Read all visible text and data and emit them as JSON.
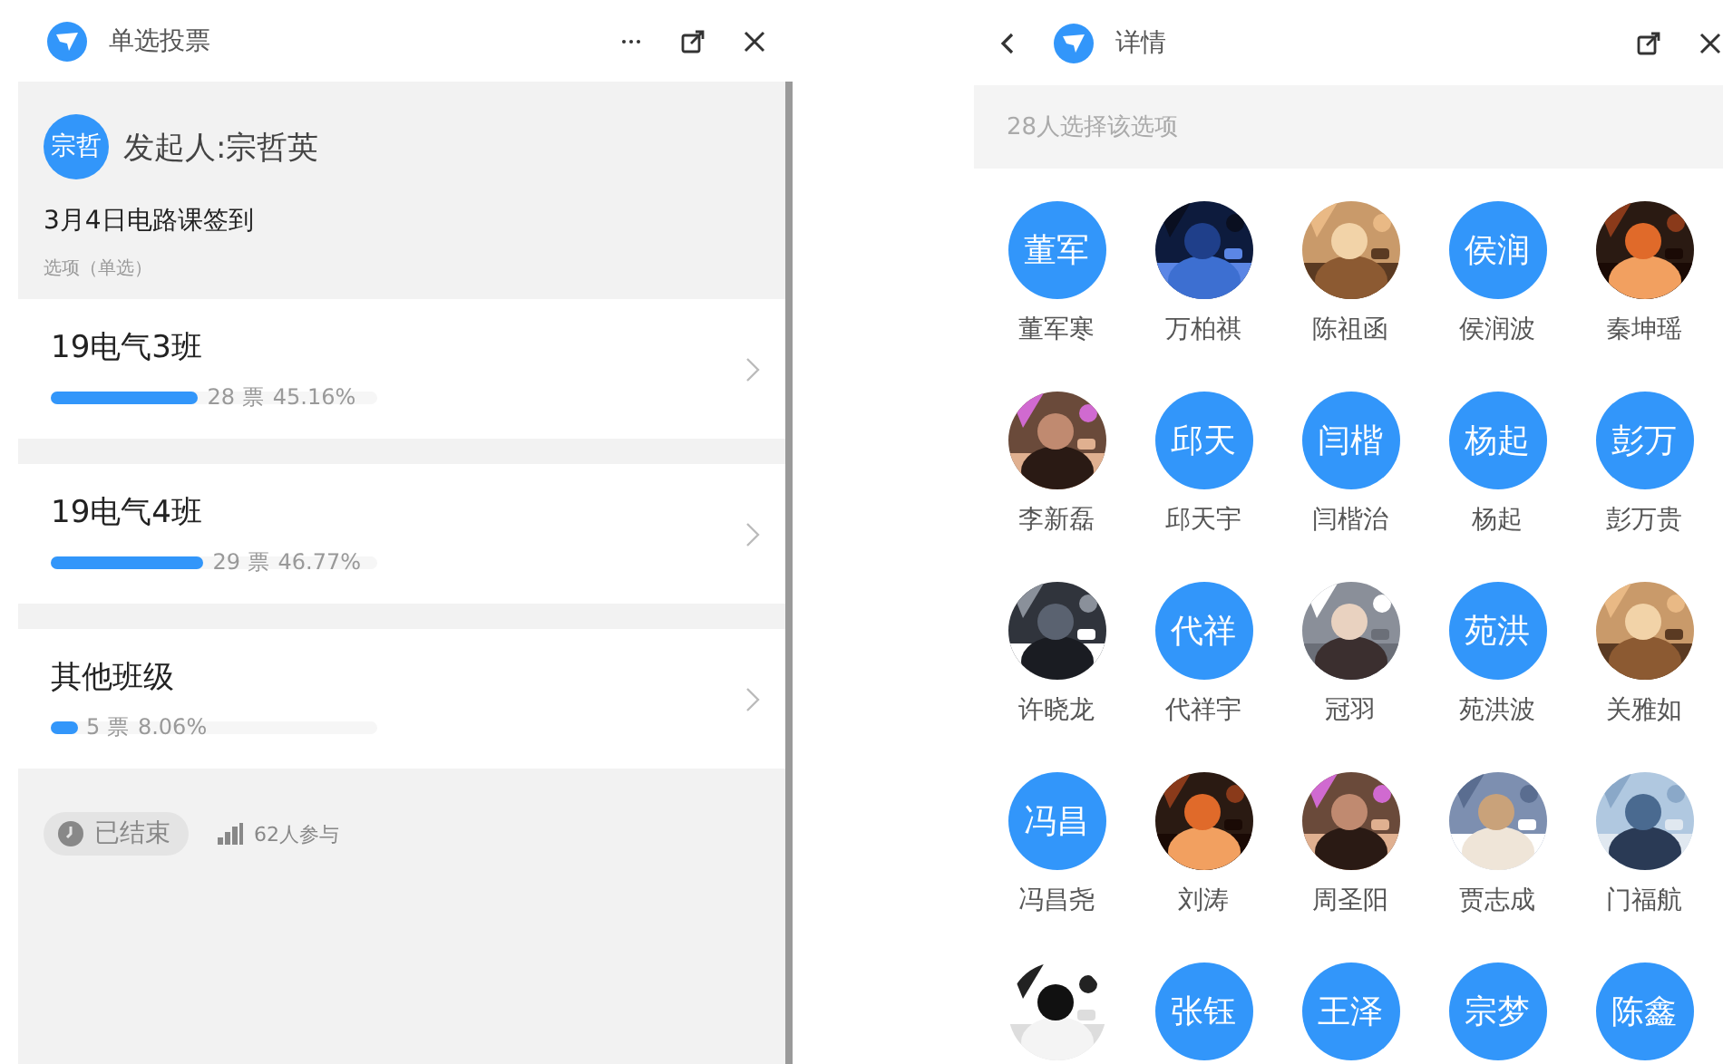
{
  "vote_window": {
    "title": "单选投票",
    "creator": {
      "avatar_text": "宗哲",
      "label": "发起人:宗哲英"
    },
    "topic": "3月4日电路课签到",
    "option_type": "选项（单选）",
    "options": [
      {
        "label": "19电气3班",
        "level": 0.4516,
        "votes": "28 票",
        "percent": "45.16%"
      },
      {
        "label": "19电气4班",
        "level": 0.4677,
        "votes": "29 票",
        "percent": "46.77%"
      },
      {
        "label": "其他班级",
        "level": 0.0806,
        "votes": "5 票",
        "percent": "8.06%"
      }
    ],
    "status": "已结束",
    "participants": "62人参与"
  },
  "detail_window": {
    "title": "详情",
    "summary": "28人选择该选项",
    "voters": [
      {
        "kind": "text",
        "initials": "董军",
        "name": "董军寒"
      },
      {
        "kind": "picture",
        "name": "万柏祺"
      },
      {
        "kind": "picture",
        "name": "陈祖函"
      },
      {
        "kind": "text",
        "initials": "侯润",
        "name": "侯润波"
      },
      {
        "kind": "picture",
        "name": "秦坤瑶"
      },
      {
        "kind": "picture",
        "name": "李新磊"
      },
      {
        "kind": "text",
        "initials": "邱天",
        "name": "邱天宇"
      },
      {
        "kind": "text",
        "initials": "闫楷",
        "name": "闫楷治"
      },
      {
        "kind": "text",
        "initials": "杨起",
        "name": "杨起"
      },
      {
        "kind": "text",
        "initials": "彭万",
        "name": "彭万贵"
      },
      {
        "kind": "picture",
        "name": "许晓龙"
      },
      {
        "kind": "text",
        "initials": "代祥",
        "name": "代祥宇"
      },
      {
        "kind": "picture",
        "name": "冠羽"
      },
      {
        "kind": "text",
        "initials": "苑洪",
        "name": "苑洪波"
      },
      {
        "kind": "picture",
        "name": "关雅如"
      },
      {
        "kind": "text",
        "initials": "冯昌",
        "name": "冯昌尧"
      },
      {
        "kind": "picture",
        "name": "刘涛"
      },
      {
        "kind": "picture",
        "name": "周圣阳"
      },
      {
        "kind": "picture",
        "name": "贾志成"
      },
      {
        "kind": "picture",
        "name": "门福航"
      },
      {
        "kind": "picture"
      },
      {
        "kind": "text",
        "initials": "张钰"
      },
      {
        "kind": "text",
        "initials": "王泽"
      },
      {
        "kind": "text",
        "initials": "宗梦"
      },
      {
        "kind": "text",
        "initials": "陈鑫"
      }
    ]
  }
}
